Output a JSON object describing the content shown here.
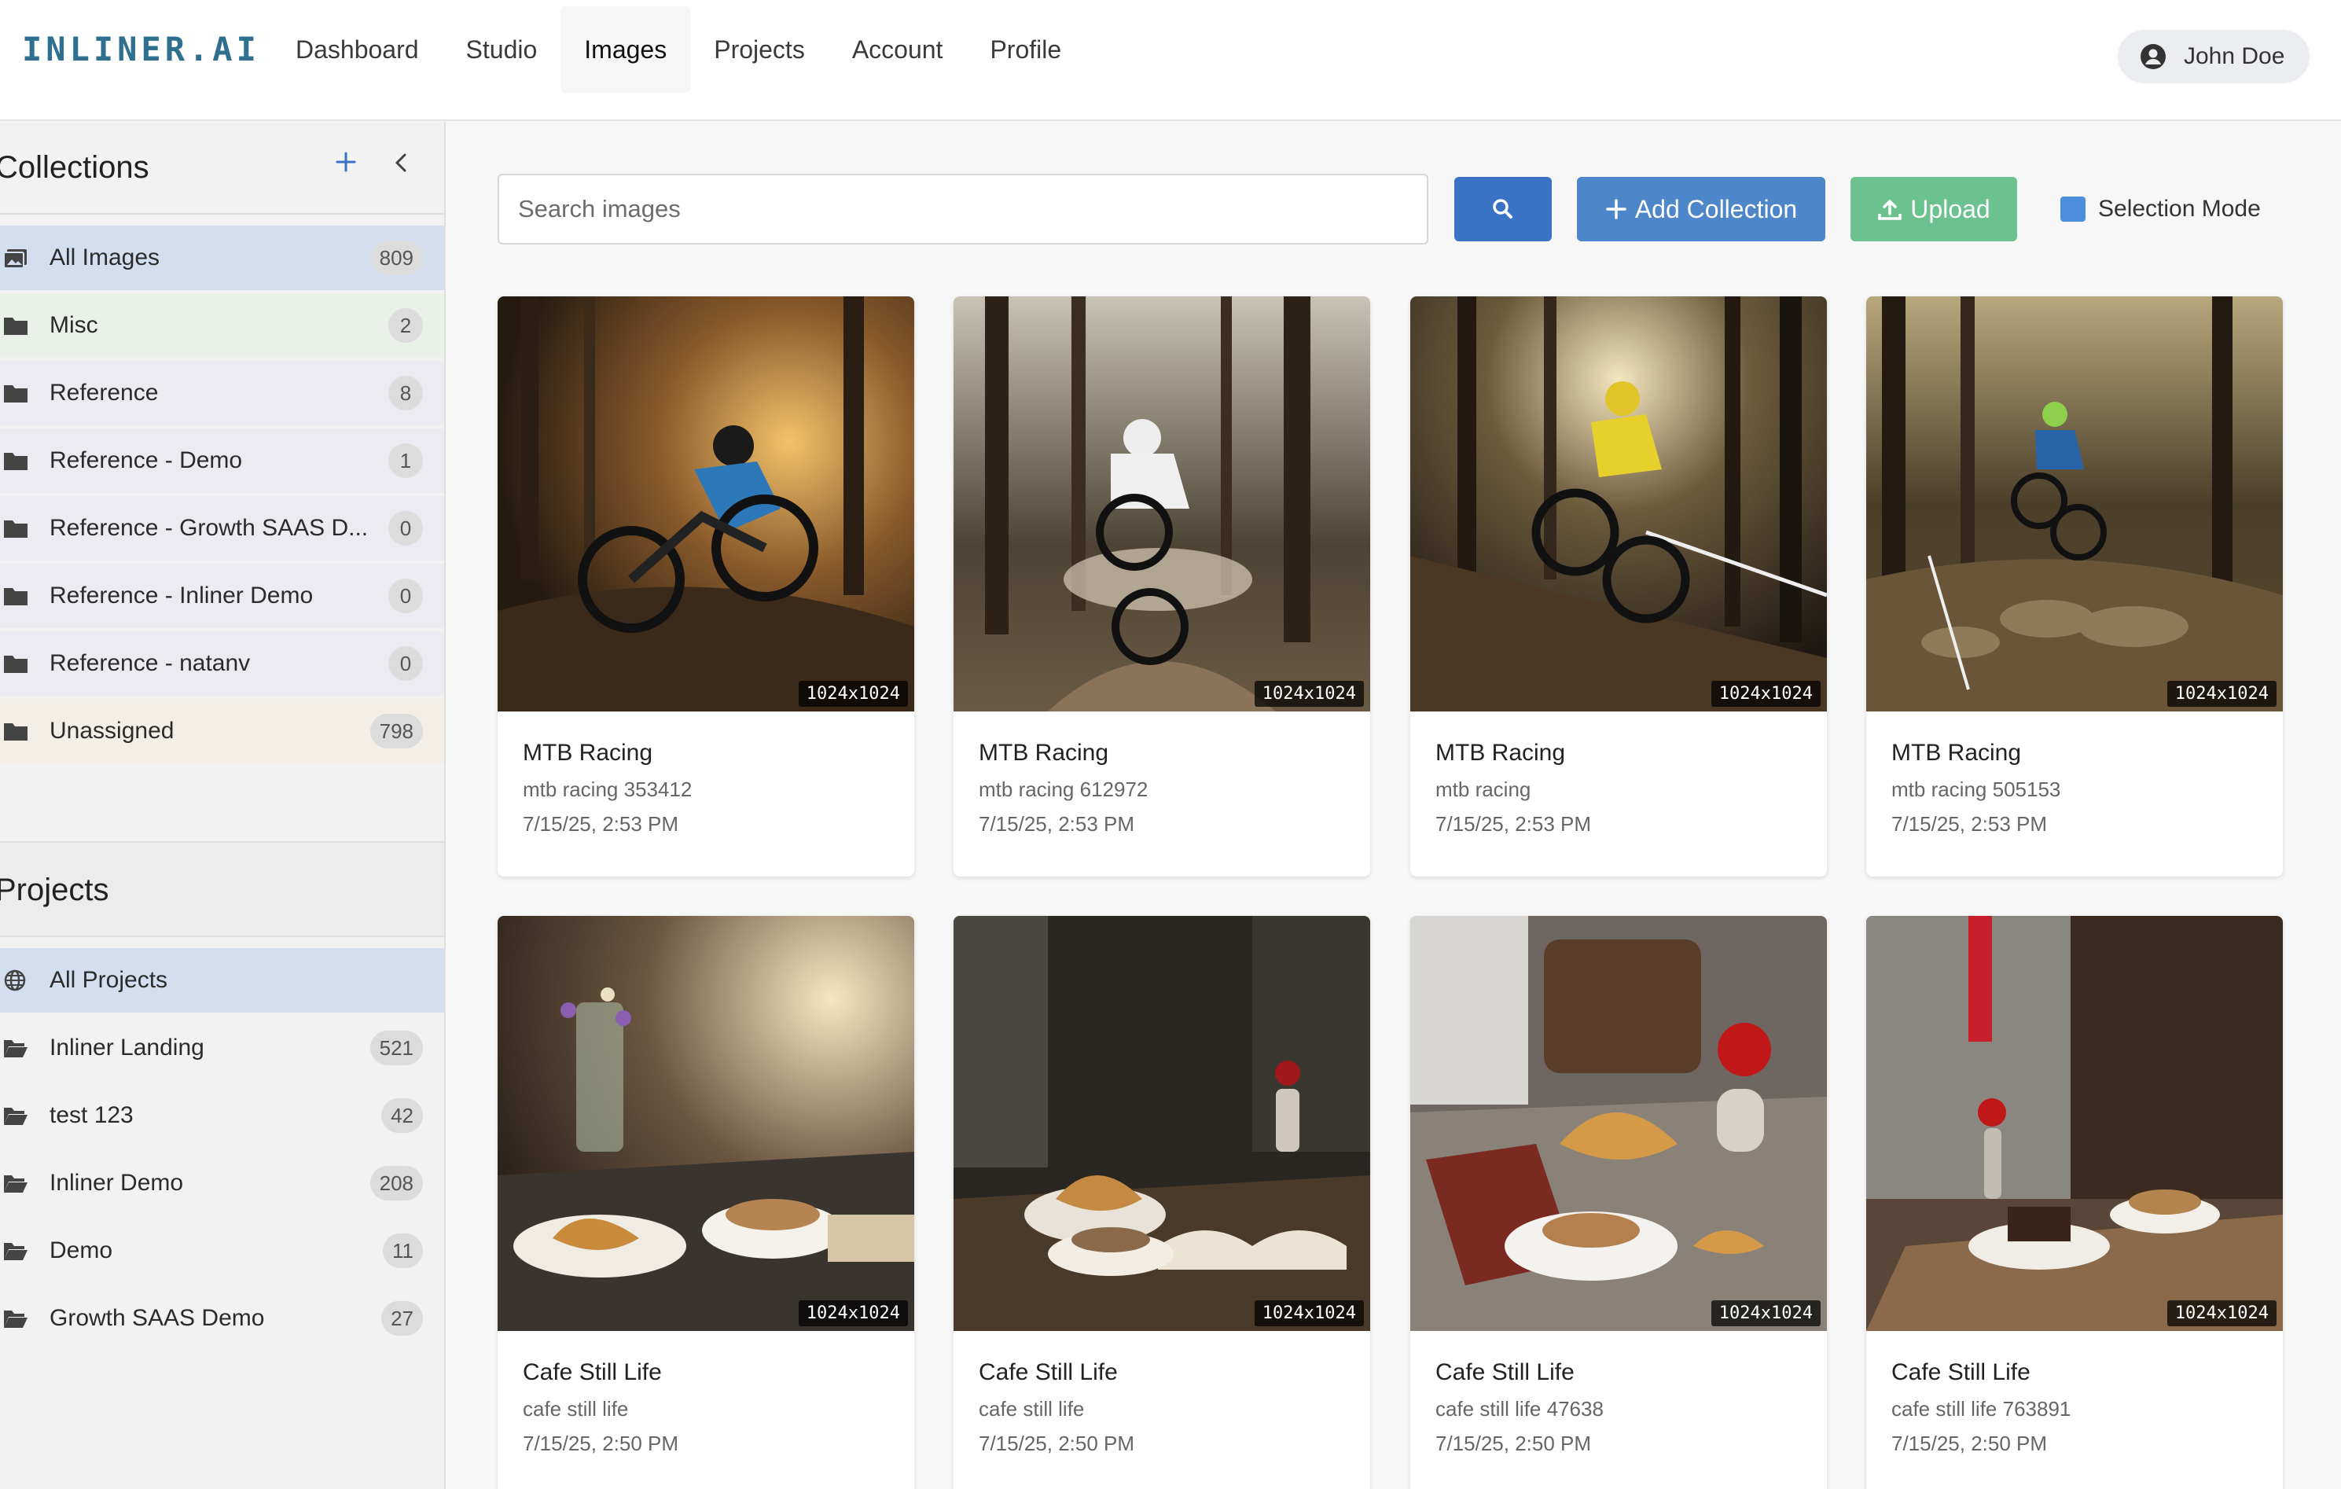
{
  "app": {
    "logo": "INLINER.AI"
  },
  "nav": [
    "Dashboard",
    "Studio",
    "Images",
    "Projects",
    "Account",
    "Profile"
  ],
  "user": {
    "name": "John Doe"
  },
  "collections": {
    "title": "Collections",
    "items": [
      {
        "label": "All Images",
        "count": "809"
      },
      {
        "label": "Misc",
        "count": "2"
      },
      {
        "label": "Reference",
        "count": "8"
      },
      {
        "label": "Reference - Demo",
        "count": "1"
      },
      {
        "label": "Reference - Growth SAAS D...",
        "count": "0"
      },
      {
        "label": "Reference - Inliner Demo",
        "count": "0"
      },
      {
        "label": "Reference - natanv",
        "count": "0"
      },
      {
        "label": "Unassigned",
        "count": "798"
      }
    ]
  },
  "projects": {
    "title": "Projects",
    "items": [
      {
        "label": "All Projects"
      },
      {
        "label": "Inliner Landing",
        "count": "521"
      },
      {
        "label": "test 123",
        "count": "42"
      },
      {
        "label": "Inliner Demo",
        "count": "208"
      },
      {
        "label": "Demo",
        "count": "11"
      },
      {
        "label": "Growth SAAS Demo",
        "count": "27"
      }
    ]
  },
  "toolbar": {
    "search_placeholder": "Search images",
    "add_collection": "Add Collection",
    "upload": "Upload",
    "selection_mode": "Selection Mode"
  },
  "images": [
    {
      "title": "MTB Racing",
      "subtitle": "mtb racing 353412",
      "date": "7/15/25, 2:53 PM",
      "dims": "1024x1024"
    },
    {
      "title": "MTB Racing",
      "subtitle": "mtb racing 612972",
      "date": "7/15/25, 2:53 PM",
      "dims": "1024x1024"
    },
    {
      "title": "MTB Racing",
      "subtitle": "mtb racing",
      "date": "7/15/25, 2:53 PM",
      "dims": "1024x1024"
    },
    {
      "title": "MTB Racing",
      "subtitle": "mtb racing 505153",
      "date": "7/15/25, 2:53 PM",
      "dims": "1024x1024"
    },
    {
      "title": "Cafe Still Life",
      "subtitle": "cafe still life",
      "date": "7/15/25, 2:50 PM",
      "dims": "1024x1024"
    },
    {
      "title": "Cafe Still Life",
      "subtitle": "cafe still life",
      "date": "7/15/25, 2:50 PM",
      "dims": "1024x1024"
    },
    {
      "title": "Cafe Still Life",
      "subtitle": "cafe still life 47638",
      "date": "7/15/25, 2:50 PM",
      "dims": "1024x1024"
    },
    {
      "title": "Cafe Still Life",
      "subtitle": "cafe still life 763891",
      "date": "7/15/25, 2:50 PM",
      "dims": "1024x1024"
    }
  ],
  "colors": {
    "primary": "#3a72c6",
    "add": "#4d87c9",
    "upload": "#6cc28f",
    "logo": "#2f6f8f"
  }
}
